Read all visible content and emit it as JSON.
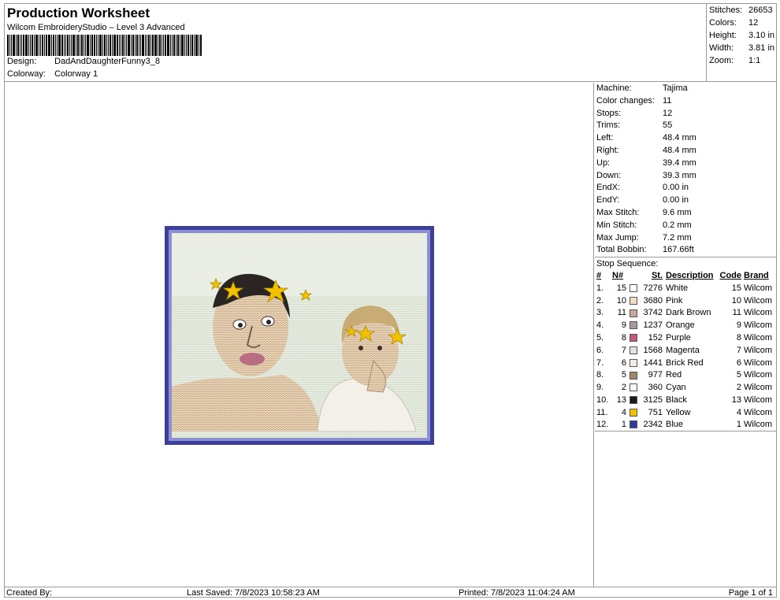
{
  "header": {
    "title": "Production Worksheet",
    "software": "Wilcom EmbroideryStudio – Level 3 Advanced",
    "design_label": "Design:",
    "design_value": "DadAndDaughterFunny3_8",
    "colorway_label": "Colorway:",
    "colorway_value": "Colorway 1"
  },
  "summary": [
    {
      "label": "Stitches:",
      "value": "26653"
    },
    {
      "label": "Colors:",
      "value": "12"
    },
    {
      "label": "Height:",
      "value": "3.10 in"
    },
    {
      "label": "Width:",
      "value": "3.81 in"
    },
    {
      "label": "Zoom:",
      "value": "1:1"
    }
  ],
  "machine_info": [
    {
      "label": "Machine:",
      "value": "Tajima"
    },
    {
      "label": "Color changes:",
      "value": "11"
    },
    {
      "label": "Stops:",
      "value": "12"
    },
    {
      "label": "Trims:",
      "value": "55"
    },
    {
      "label": "Left:",
      "value": "48.4 mm"
    },
    {
      "label": "Right:",
      "value": "48.4 mm"
    },
    {
      "label": "Up:",
      "value": "39.4 mm"
    },
    {
      "label": "Down:",
      "value": "39.3 mm"
    },
    {
      "label": "EndX:",
      "value": "0.00 in"
    },
    {
      "label": "EndY:",
      "value": "0.00 in"
    },
    {
      "label": "Max Stitch:",
      "value": "9.6 mm"
    },
    {
      "label": "Min Stitch:",
      "value": "0.2 mm"
    },
    {
      "label": "Max Jump:",
      "value": "7.2 mm"
    },
    {
      "label": "Total Bobbin:",
      "value": "167.66ft"
    }
  ],
  "stop_sequence": {
    "title": "Stop Sequence:",
    "headers": [
      "#",
      "N#",
      "St.",
      "Description",
      "Code",
      "Brand"
    ],
    "rows": [
      {
        "idx": "1.",
        "n": "15",
        "color": "#ffffff",
        "st": "7276",
        "desc": "White",
        "code": "15",
        "brand": "Wilcom"
      },
      {
        "idx": "2.",
        "n": "10",
        "color": "#f3dcc4",
        "st": "3680",
        "desc": "Pink",
        "code": "10",
        "brand": "Wilcom"
      },
      {
        "idx": "3.",
        "n": "11",
        "color": "#c7a79c",
        "st": "3742",
        "desc": "Dark Brown",
        "code": "11",
        "brand": "Wilcom"
      },
      {
        "idx": "4.",
        "n": "9",
        "color": "#a99aa0",
        "st": "1237",
        "desc": "Orange",
        "code": "9",
        "brand": "Wilcom"
      },
      {
        "idx": "5.",
        "n": "8",
        "color": "#c25a78",
        "st": "152",
        "desc": "Purple",
        "code": "8",
        "brand": "Wilcom"
      },
      {
        "idx": "6.",
        "n": "7",
        "color": "#e2e2e2",
        "st": "1568",
        "desc": "Magenta",
        "code": "7",
        "brand": "Wilcom"
      },
      {
        "idx": "7.",
        "n": "6",
        "color": "#f5ece8",
        "st": "1441",
        "desc": "Brick Red",
        "code": "6",
        "brand": "Wilcom"
      },
      {
        "idx": "8.",
        "n": "5",
        "color": "#9c8866",
        "st": "977",
        "desc": "Red",
        "code": "5",
        "brand": "Wilcom"
      },
      {
        "idx": "9.",
        "n": "2",
        "color": "#f8f8f4",
        "st": "360",
        "desc": "Cyan",
        "code": "2",
        "brand": "Wilcom"
      },
      {
        "idx": "10.",
        "n": "13",
        "color": "#1a1a1a",
        "st": "3125",
        "desc": "Black",
        "code": "13",
        "brand": "Wilcom"
      },
      {
        "idx": "11.",
        "n": "4",
        "color": "#f2c200",
        "st": "751",
        "desc": "Yellow",
        "code": "4",
        "brand": "Wilcom"
      },
      {
        "idx": "12.",
        "n": "1",
        "color": "#2f3a9a",
        "st": "2342",
        "desc": "Blue",
        "code": "1",
        "brand": "Wilcom"
      }
    ]
  },
  "footer": {
    "created_by": "Created By:",
    "last_saved": "Last Saved: 7/8/2023 10:58:23 AM",
    "printed": "Printed: 7/8/2023 11:04:24 AM",
    "page": "Page 1 of 1"
  }
}
